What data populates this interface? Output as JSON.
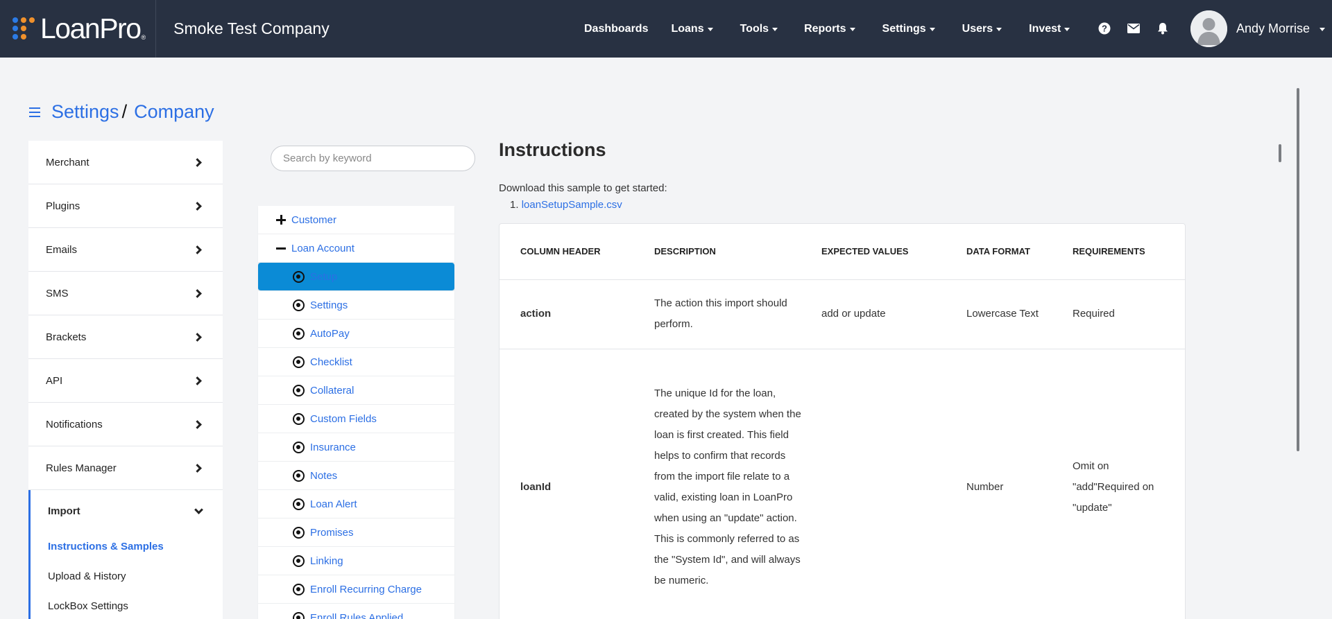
{
  "brand": {
    "logo_text": "LoanPro",
    "company": "Smoke Test Company"
  },
  "nav": [
    {
      "label": "Dashboards",
      "dropdown": false
    },
    {
      "label": "Loans",
      "dropdown": true
    },
    {
      "label": "Tools",
      "dropdown": true
    },
    {
      "label": "Reports",
      "dropdown": true
    },
    {
      "label": "Settings",
      "dropdown": true
    },
    {
      "label": "Users",
      "dropdown": true
    },
    {
      "label": "Invest",
      "dropdown": true
    }
  ],
  "nav_icons": [
    "help-icon",
    "mail-icon",
    "bell-icon"
  ],
  "user": {
    "name": "Andy Morrise"
  },
  "breadcrumb": {
    "first": "Settings",
    "separator": "/",
    "second": "Company"
  },
  "left_menu": {
    "items": [
      {
        "label": "Merchant"
      },
      {
        "label": "Plugins"
      },
      {
        "label": "Emails"
      },
      {
        "label": "SMS"
      },
      {
        "label": "Brackets"
      },
      {
        "label": "API"
      },
      {
        "label": "Notifications"
      },
      {
        "label": "Rules Manager"
      }
    ],
    "import": {
      "label": "Import",
      "subitems": [
        {
          "label": "Instructions & Samples",
          "active": true
        },
        {
          "label": "Upload & History",
          "active": false
        },
        {
          "label": "LockBox Settings",
          "active": false
        }
      ]
    }
  },
  "search": {
    "placeholder": "Search by keyword"
  },
  "tree": {
    "customer": "Customer",
    "loan_account": "Loan Account",
    "children": [
      "Setup",
      "Settings",
      "AutoPay",
      "Checklist",
      "Collateral",
      "Custom Fields",
      "Insurance",
      "Notes",
      "Loan Alert",
      "Promises",
      "Linking",
      "Enroll Recurring Charge",
      "Enroll Rules Applied"
    ],
    "selected": "Setup"
  },
  "main": {
    "title": "Instructions",
    "download_text": "Download this sample to get started:",
    "sample_file": "loanSetupSample.csv",
    "table": {
      "headers": [
        "COLUMN HEADER",
        "DESCRIPTION",
        "EXPECTED VALUES",
        "DATA FORMAT",
        "REQUIREMENTS"
      ],
      "rows": [
        {
          "column": "action",
          "description": "The action this import should perform.",
          "expected": "add or update",
          "format": "Lowercase Text",
          "requirements": "Required"
        },
        {
          "column": "loanId",
          "description": "The unique Id for the loan, created by the system when the loan is first created. This field helps to confirm that records from the import file relate to a valid, existing loan in LoanPro when using an \"update\" action. This is commonly referred to as the \"System Id\", and will always be numeric.",
          "expected": "",
          "format": "Number",
          "requirements": "Omit on \"add\"Required on \"update\""
        }
      ]
    }
  },
  "colors": {
    "topbar": "#283142",
    "accent": "#2c6fe4",
    "selected": "#0b8bd6",
    "logo_orange": "#f0912c"
  }
}
